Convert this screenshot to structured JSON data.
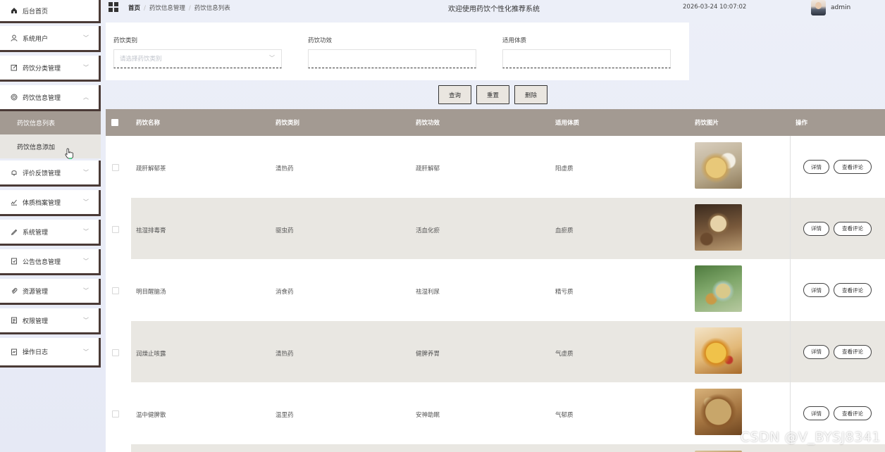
{
  "sidebar": {
    "items": [
      {
        "label": "后台首页",
        "icon": "home-icon"
      },
      {
        "label": "系统用户",
        "icon": "user-icon"
      },
      {
        "label": "药饮分类管理",
        "icon": "edit-icon"
      },
      {
        "label": "药饮信息管理",
        "icon": "globe-icon"
      },
      {
        "label": "评价反馈管理",
        "icon": "bell-icon"
      },
      {
        "label": "体质档案管理",
        "icon": "chart-icon"
      },
      {
        "label": "系统管理",
        "icon": "pen-icon"
      },
      {
        "label": "公告信息管理",
        "icon": "notice-icon"
      },
      {
        "label": "资源管理",
        "icon": "clip-icon"
      },
      {
        "label": "权限管理",
        "icon": "doc-icon"
      },
      {
        "label": "操作日志",
        "icon": "log-icon"
      }
    ],
    "sub_items": [
      {
        "label": "药饮信息列表"
      },
      {
        "label": "药饮信息添加"
      }
    ]
  },
  "header": {
    "breadcrumb": [
      "首页",
      "药饮信息管理",
      "药饮信息列表"
    ],
    "title": "欢迎使用药饮个性化推荐系统",
    "datetime": "2026-03-24 10:07:02",
    "username": "admin"
  },
  "filters": [
    {
      "label": "药饮类别",
      "placeholder": "请选择药饮类别",
      "type": "select"
    },
    {
      "label": "药饮功效",
      "placeholder": "",
      "type": "input"
    },
    {
      "label": "适用体质",
      "placeholder": "",
      "type": "input"
    }
  ],
  "buttons": {
    "query": "查询",
    "reset": "重置",
    "delete": "删除"
  },
  "table": {
    "columns": [
      "药饮名称",
      "药饮类别",
      "药饮功效",
      "适用体质",
      "药饮图片",
      "操作"
    ],
    "actions": {
      "detail": "详情",
      "review": "查看评论"
    },
    "rows": [
      {
        "name": "疏肝解郁茶",
        "category": "清热药",
        "effect": "疏肝解郁",
        "constitution": "阳虚质"
      },
      {
        "name": "祛湿排毒膏",
        "category": "驱虫药",
        "effect": "活血化瘀",
        "constitution": "血瘀质"
      },
      {
        "name": "明目醒脑汤",
        "category": "消食药",
        "effect": "祛湿利尿",
        "constitution": "精亏质"
      },
      {
        "name": "润燥止咳露",
        "category": "清热药",
        "effect": "健脾养胃",
        "constitution": "气虚质"
      },
      {
        "name": "温中健脾散",
        "category": "温里药",
        "effect": "安神助眠",
        "constitution": "气郁质"
      }
    ]
  },
  "watermark": "CSDN @V_BYSJ8341",
  "colors": {
    "accent": "#a39a92",
    "border_dark": "#4a3a36",
    "stripe": "#e9e7e2"
  }
}
